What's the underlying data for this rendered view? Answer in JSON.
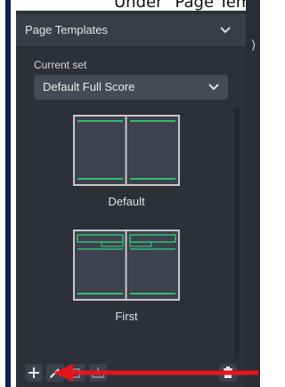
{
  "caption": "Under \"Page Tem",
  "panel": {
    "title": "Page Templates",
    "current_set_label": "Current set",
    "current_set_value": "Default Full Score"
  },
  "templates": [
    {
      "name": "Default"
    },
    {
      "name": "First"
    }
  ],
  "colors": {
    "panel_bg": "#2e3038",
    "header_bg": "#3a3d46",
    "accent_green": "#2fbf71",
    "arrow_red": "#e8141b"
  },
  "icons": {
    "add": "plus-icon",
    "edit": "pencil-icon",
    "import": "import-icon",
    "export": "export-icon",
    "delete": "trash-icon"
  }
}
